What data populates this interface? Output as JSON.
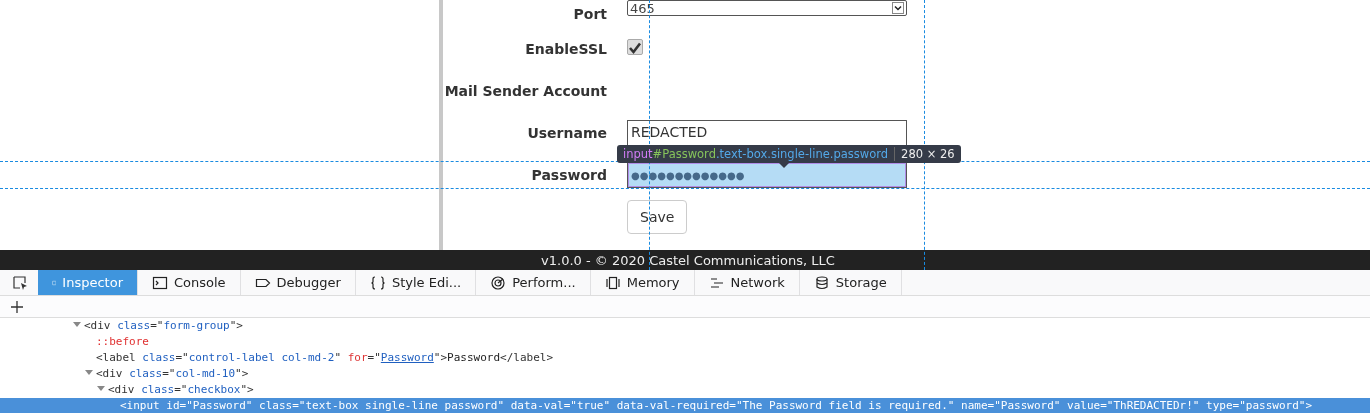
{
  "form": {
    "fields": [
      {
        "label": "Port",
        "kind": "select",
        "value": "465"
      },
      {
        "label": "EnableSSL",
        "kind": "checkbox",
        "checked": true
      },
      {
        "label": "Mail Sender Account",
        "kind": "heading"
      },
      {
        "label": "Username",
        "kind": "text",
        "value": "REDACTED"
      },
      {
        "label": "Password",
        "kind": "password",
        "value": "●●●●●●●●●●●●●",
        "highlighted": true
      }
    ],
    "save_button": "Save"
  },
  "tooltip": {
    "tag": "input",
    "id": "#Password",
    "classes": ".text-box.single-line.password",
    "size": "280 × 26"
  },
  "footer": "v1.0.0 - © 2020 Castel Communications, LLC",
  "devtools": {
    "tabs": [
      {
        "label": "Inspector",
        "selected": true
      },
      {
        "label": "Console",
        "selected": false
      },
      {
        "label": "Debugger",
        "selected": false
      },
      {
        "label": "Style Edi...",
        "selected": false
      },
      {
        "label": "Perform...",
        "selected": false
      },
      {
        "label": "Memory",
        "selected": false
      },
      {
        "label": "Network",
        "selected": false
      },
      {
        "label": "Storage",
        "selected": false
      }
    ],
    "markup": [
      {
        "expanded": true,
        "selected": false,
        "tokens": [
          {
            "kind": "tag",
            "text": "<div "
          },
          {
            "kind": "attr",
            "text": "class"
          },
          {
            "kind": "tag",
            "text": "=\""
          },
          {
            "kind": "val",
            "text": "form-group"
          },
          {
            "kind": "tag",
            "text": "\">"
          }
        ],
        "children": [
          {
            "selected": false,
            "tokens": [
              {
                "kind": "pseudo",
                "text": "::before"
              }
            ]
          },
          {
            "selected": false,
            "tokens": [
              {
                "kind": "tag",
                "text": "<label "
              },
              {
                "kind": "attr",
                "text": "class"
              },
              {
                "kind": "tag",
                "text": "=\""
              },
              {
                "kind": "val",
                "text": "control-label col-md-2"
              },
              {
                "kind": "tag",
                "text": "\" "
              },
              {
                "kind": "attr2",
                "text": "for"
              },
              {
                "kind": "tag",
                "text": "=\""
              },
              {
                "kind": "link",
                "text": "Password"
              },
              {
                "kind": "tag",
                "text": "\">"
              },
              {
                "kind": "text",
                "text": "Password"
              },
              {
                "kind": "tag",
                "text": "</label>"
              }
            ]
          },
          {
            "expanded": true,
            "selected": false,
            "tokens": [
              {
                "kind": "tag",
                "text": "<div "
              },
              {
                "kind": "attr",
                "text": "class"
              },
              {
                "kind": "tag",
                "text": "=\""
              },
              {
                "kind": "val",
                "text": "col-md-10"
              },
              {
                "kind": "tag",
                "text": "\">"
              }
            ],
            "children": [
              {
                "expanded": true,
                "selected": false,
                "tokens": [
                  {
                    "kind": "tag",
                    "text": "<div "
                  },
                  {
                    "kind": "attr",
                    "text": "class"
                  },
                  {
                    "kind": "tag",
                    "text": "=\""
                  },
                  {
                    "kind": "val",
                    "text": "checkbox"
                  },
                  {
                    "kind": "tag",
                    "text": "\">"
                  }
                ],
                "children": [
                  {
                    "selected": true,
                    "tokens": [
                      {
                        "text": "<input id=\"Password\" class=\"text-box single-line password\" data-val=\"true\" data-val-required=\"The Password field is required.\" name=\"Password\" value=\"ThREDACTEDr!\" type=\"password\">"
                      }
                    ]
                  }
                ]
              }
            ]
          }
        ]
      }
    ]
  }
}
